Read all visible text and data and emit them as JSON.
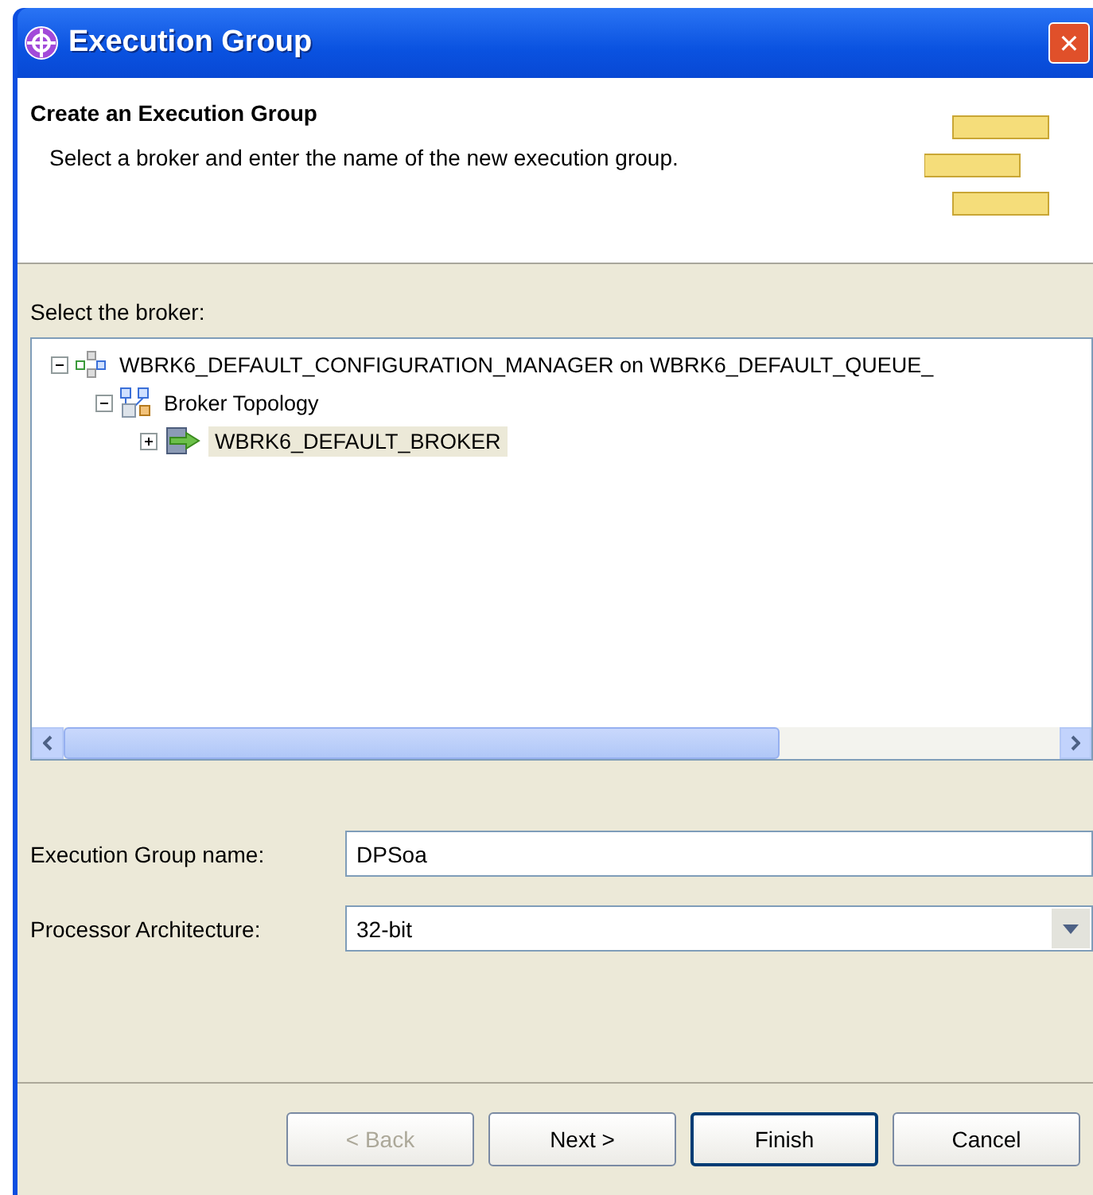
{
  "window": {
    "title": "Execution Group",
    "close": "✕"
  },
  "header": {
    "title": "Create an Execution Group",
    "description": "Select a broker and enter the name of the new execution group."
  },
  "tree": {
    "label": "Select the broker:",
    "nodes": [
      {
        "label": "WBRK6_DEFAULT_CONFIGURATION_MANAGER on WBRK6_DEFAULT_QUEUE_",
        "kind": "manager",
        "expanded": true,
        "selected": false,
        "children": [
          {
            "label": "Broker Topology",
            "kind": "topology",
            "expanded": true,
            "selected": false,
            "children": [
              {
                "label": "WBRK6_DEFAULT_BROKER",
                "kind": "broker",
                "expanded": false,
                "selected": true
              }
            ]
          }
        ]
      }
    ]
  },
  "fields": [
    {
      "label": "Execution Group name:",
      "kind": "text",
      "value": "DPSoa"
    },
    {
      "label": "Processor Architecture:",
      "kind": "select",
      "value": "32-bit"
    }
  ],
  "buttons": [
    {
      "label": "< Back",
      "disabled": true,
      "default": false
    },
    {
      "label": "Next >",
      "disabled": false,
      "default": false
    },
    {
      "label": "Finish",
      "disabled": false,
      "default": true
    },
    {
      "label": "Cancel",
      "disabled": false,
      "default": false
    }
  ]
}
